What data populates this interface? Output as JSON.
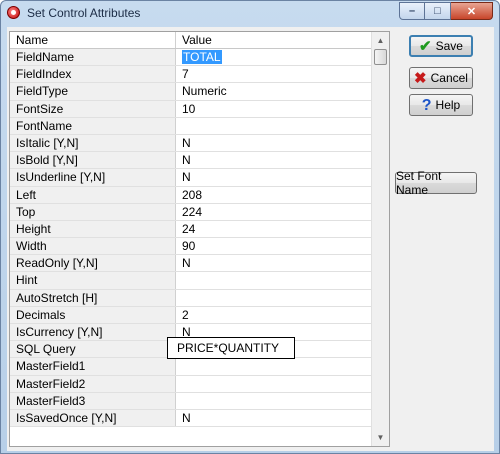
{
  "window": {
    "title": "Set Control Attributes",
    "buttons": {
      "minimize": "–",
      "maximize": "□",
      "close": "✕"
    }
  },
  "grid": {
    "columns": [
      "Name",
      "Value"
    ],
    "rows": [
      {
        "name": "FieldName",
        "value": "TOTAL"
      },
      {
        "name": "FieldIndex",
        "value": "7"
      },
      {
        "name": "FieldType",
        "value": "Numeric"
      },
      {
        "name": "FontSize",
        "value": "10"
      },
      {
        "name": "FontName",
        "value": ""
      },
      {
        "name": "IsItalic [Y,N]",
        "value": "N"
      },
      {
        "name": "IsBold [Y,N]",
        "value": "N"
      },
      {
        "name": "IsUnderline [Y,N]",
        "value": "N"
      },
      {
        "name": "Left",
        "value": "208"
      },
      {
        "name": "Top",
        "value": "224"
      },
      {
        "name": "Height",
        "value": "24"
      },
      {
        "name": "Width",
        "value": "90"
      },
      {
        "name": "ReadOnly [Y,N]",
        "value": "N"
      },
      {
        "name": "Hint",
        "value": ""
      },
      {
        "name": "AutoStretch [H]",
        "value": ""
      },
      {
        "name": "Decimals",
        "value": "2"
      },
      {
        "name": "IsCurrency [Y,N]",
        "value": "N"
      },
      {
        "name": "SQL Query",
        "value": "PRICE*QUANTITY"
      },
      {
        "name": "MasterField1",
        "value": ""
      },
      {
        "name": "MasterField2",
        "value": ""
      },
      {
        "name": "MasterField3",
        "value": ""
      },
      {
        "name": "IsSavedOnce [Y,N]",
        "value": "N"
      }
    ]
  },
  "actions": {
    "save": "Save",
    "cancel": "Cancel",
    "help": "Help",
    "set_font_name": "Set Font Name"
  },
  "icons": {
    "save": "check-icon",
    "cancel": "x-icon",
    "help": "question-icon"
  }
}
